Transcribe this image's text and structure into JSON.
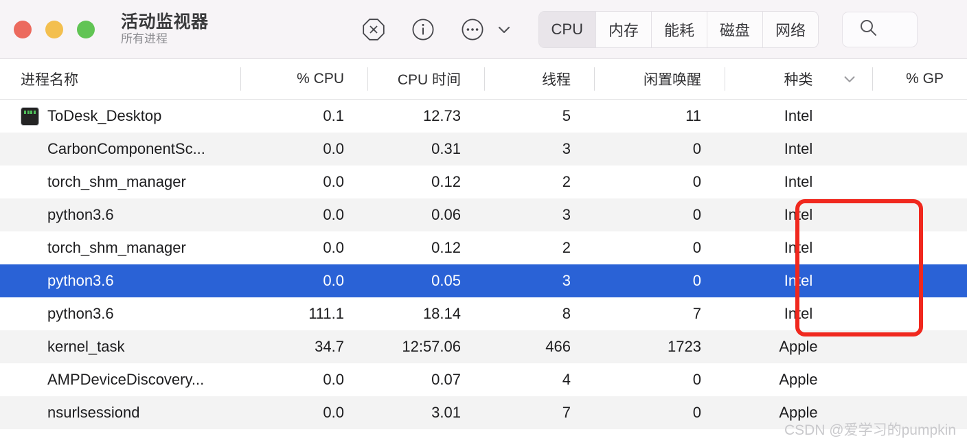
{
  "window": {
    "title": "活动监视器",
    "subtitle": "所有进程",
    "traffic_lights": [
      {
        "name": "close",
        "color": "#ec6a5e"
      },
      {
        "name": "minimize",
        "color": "#f3bf4f"
      },
      {
        "name": "zoom",
        "color": "#61c454"
      }
    ]
  },
  "toolbar": {
    "icons": [
      {
        "name": "stop-process-icon",
        "glyph": "octagon-x"
      },
      {
        "name": "inspect-process-icon",
        "glyph": "info-circle"
      },
      {
        "name": "more-options-icon",
        "glyph": "ellipsis-circle"
      },
      {
        "name": "chevron-down-icon",
        "glyph": "chevron-down"
      }
    ],
    "tabs": [
      {
        "label": "CPU",
        "selected": true
      },
      {
        "label": "内存",
        "selected": false
      },
      {
        "label": "能耗",
        "selected": false
      },
      {
        "label": "磁盘",
        "selected": false
      },
      {
        "label": "网络",
        "selected": false
      }
    ],
    "search": {
      "icon": "search-icon",
      "placeholder": "",
      "value": ""
    }
  },
  "table": {
    "columns": [
      {
        "key": "name",
        "label": "进程名称",
        "sorted": false
      },
      {
        "key": "cpu",
        "label": "% CPU",
        "sorted": false
      },
      {
        "key": "time",
        "label": "CPU 时间",
        "sorted": false
      },
      {
        "key": "threads",
        "label": "线程",
        "sorted": false
      },
      {
        "key": "idle",
        "label": "闲置唤醒",
        "sorted": false
      },
      {
        "key": "kind",
        "label": "种类",
        "sorted": true,
        "sort_direction": "descending"
      },
      {
        "key": "gpu",
        "label": "% GP",
        "sorted": false,
        "truncated": true
      }
    ],
    "rows": [
      {
        "name": "ToDesk_Desktop",
        "cpu": "0.1",
        "time": "12.73",
        "threads": "5",
        "idle": "11",
        "kind": "Intel",
        "gpu": "",
        "icon": "terminal-app-icon",
        "selected": false,
        "highlighted": false
      },
      {
        "name": "CarbonComponentSc...",
        "cpu": "0.0",
        "time": "0.31",
        "threads": "3",
        "idle": "0",
        "kind": "Intel",
        "gpu": "",
        "icon": null,
        "selected": false,
        "highlighted": false
      },
      {
        "name": "torch_shm_manager",
        "cpu": "0.0",
        "time": "0.12",
        "threads": "2",
        "idle": "0",
        "kind": "Intel",
        "gpu": "",
        "icon": null,
        "selected": false,
        "highlighted": false
      },
      {
        "name": "python3.6",
        "cpu": "0.0",
        "time": "0.06",
        "threads": "3",
        "idle": "0",
        "kind": "Intel",
        "gpu": "",
        "icon": null,
        "selected": false,
        "highlighted": true
      },
      {
        "name": "torch_shm_manager",
        "cpu": "0.0",
        "time": "0.12",
        "threads": "2",
        "idle": "0",
        "kind": "Intel",
        "gpu": "",
        "icon": null,
        "selected": false,
        "highlighted": true
      },
      {
        "name": "python3.6",
        "cpu": "0.0",
        "time": "0.05",
        "threads": "3",
        "idle": "0",
        "kind": "Intel",
        "gpu": "",
        "icon": null,
        "selected": true,
        "highlighted": true
      },
      {
        "name": "python3.6",
        "cpu": "111.1",
        "time": "18.14",
        "threads": "8",
        "idle": "7",
        "kind": "Intel",
        "gpu": "",
        "icon": null,
        "selected": false,
        "highlighted": true
      },
      {
        "name": "kernel_task",
        "cpu": "34.7",
        "time": "12:57.06",
        "threads": "466",
        "idle": "1723",
        "kind": "Apple",
        "gpu": "",
        "icon": null,
        "selected": false,
        "highlighted": false
      },
      {
        "name": "AMPDeviceDiscovery...",
        "cpu": "0.0",
        "time": "0.07",
        "threads": "4",
        "idle": "0",
        "kind": "Apple",
        "gpu": "",
        "icon": null,
        "selected": false,
        "highlighted": false
      },
      {
        "name": "nsurlsessiond",
        "cpu": "0.0",
        "time": "3.01",
        "threads": "7",
        "idle": "0",
        "kind": "Apple",
        "gpu": "",
        "icon": null,
        "selected": false,
        "highlighted": false
      }
    ]
  },
  "annotation": {
    "shape": "rectangle",
    "color": "#f0281e",
    "target_column": "种类",
    "covers_rows": [
      4,
      5,
      6,
      7
    ]
  },
  "watermark": {
    "text": "CSDN @爱学习的pumpkin"
  },
  "colors": {
    "selection_blue": "#2a62d6",
    "toolbar_bg": "#f7f4f7",
    "row_alt_bg": "#f3f3f3",
    "annotation_red": "#f0281e"
  }
}
